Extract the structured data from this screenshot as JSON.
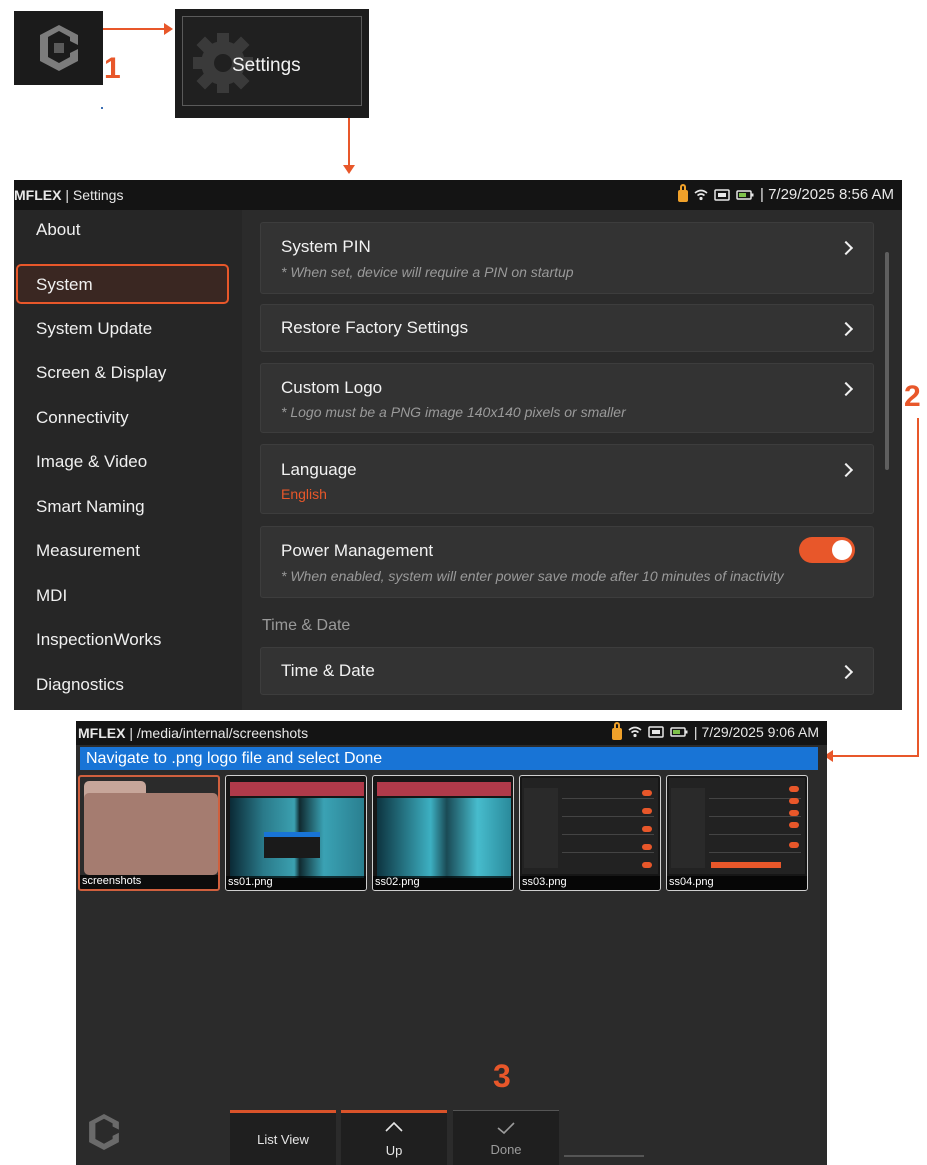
{
  "steps": {
    "one": "1",
    "two": "2",
    "three": "3"
  },
  "settings_tile": {
    "label": "Settings"
  },
  "settings_screen": {
    "status": {
      "brand": "MFLEX",
      "title": " | Settings",
      "datetime": "| 7/29/2025  8:56 AM"
    },
    "sidebar": [
      "About",
      "System",
      "System Update",
      "Screen & Display",
      "Connectivity",
      "Image & Video",
      "Smart Naming",
      "Measurement",
      "MDI",
      "InspectionWorks",
      "Diagnostics"
    ],
    "active_item": "System",
    "items": {
      "pin": {
        "title": "System PIN",
        "subtitle": "* When set, device will require a PIN on startup"
      },
      "restore": {
        "title": "Restore Factory Settings"
      },
      "logo": {
        "title": "Custom Logo",
        "subtitle": "* Logo must be a PNG image 140x140 pixels or smaller"
      },
      "language": {
        "title": "Language",
        "value": "English"
      },
      "power": {
        "title": "Power Management",
        "subtitle": "* When enabled, system will enter power save mode after 10 minutes of inactivity",
        "enabled": true
      }
    },
    "section_heading": "Time & Date",
    "time_date": {
      "title": "Time & Date"
    }
  },
  "browser": {
    "status": {
      "brand": "MFLEX",
      "path": " | /media/internal/screenshots",
      "datetime": "| 7/29/2025  9:06 AM"
    },
    "banner": "Navigate to .png logo file and select Done",
    "files": [
      "screenshots",
      "ss01.png",
      "ss02.png",
      "ss03.png",
      "ss04.png"
    ],
    "tabs": {
      "list_view": "List View",
      "up": "Up",
      "done": "Done"
    }
  },
  "colors": {
    "accent": "#e8572a",
    "banner": "#1874d6",
    "background": "#2b2b2b"
  }
}
